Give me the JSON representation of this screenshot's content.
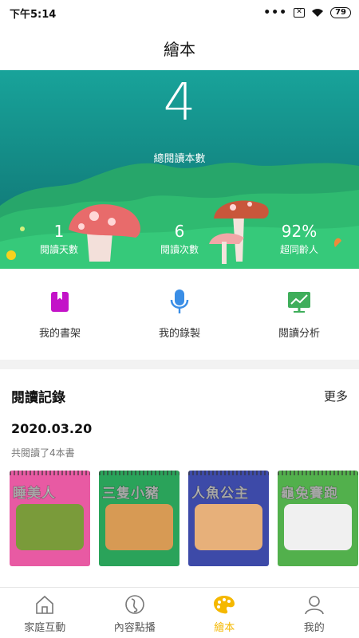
{
  "status_bar": {
    "time": "下午5:14",
    "battery": "79"
  },
  "title": "繪本",
  "hero": {
    "total_count": "4",
    "total_label": "總閱讀本數",
    "stats": [
      {
        "value": "1",
        "label": "閱讀天數"
      },
      {
        "value": "6",
        "label": "閱讀次數"
      },
      {
        "value": "92%",
        "label": "超同齡人"
      }
    ]
  },
  "actions": [
    {
      "label": "我的書架",
      "icon": "bookshelf-icon",
      "color": "#c313c8"
    },
    {
      "label": "我的錄製",
      "icon": "microphone-icon",
      "color": "#3a8ee6"
    },
    {
      "label": "閱讀分析",
      "icon": "analysis-chart-icon",
      "color": "#3fae5b"
    }
  ],
  "records": {
    "title": "閱讀記錄",
    "more": "更多",
    "date": "2020.03.20",
    "summary": "共閱讀了4本書",
    "books": [
      {
        "title": "睡美人",
        "color": "#e85aa3",
        "scene": "#7a9b3a"
      },
      {
        "title": "三隻小豬",
        "color": "#2aa35a",
        "scene": "#d79a54"
      },
      {
        "title": "人魚公主",
        "color": "#3d4aa8",
        "scene": "#e7b07a"
      },
      {
        "title": "龜兔賽跑",
        "color": "#52b04c",
        "scene": "#f0f0f0"
      }
    ]
  },
  "bottom_nav": [
    {
      "label": "家庭互動",
      "icon": "home-icon",
      "active": false
    },
    {
      "label": "內容點播",
      "icon": "content-icon",
      "active": false
    },
    {
      "label": "繪本",
      "icon": "palette-icon",
      "active": true
    },
    {
      "label": "我的",
      "icon": "user-icon",
      "active": false
    }
  ]
}
